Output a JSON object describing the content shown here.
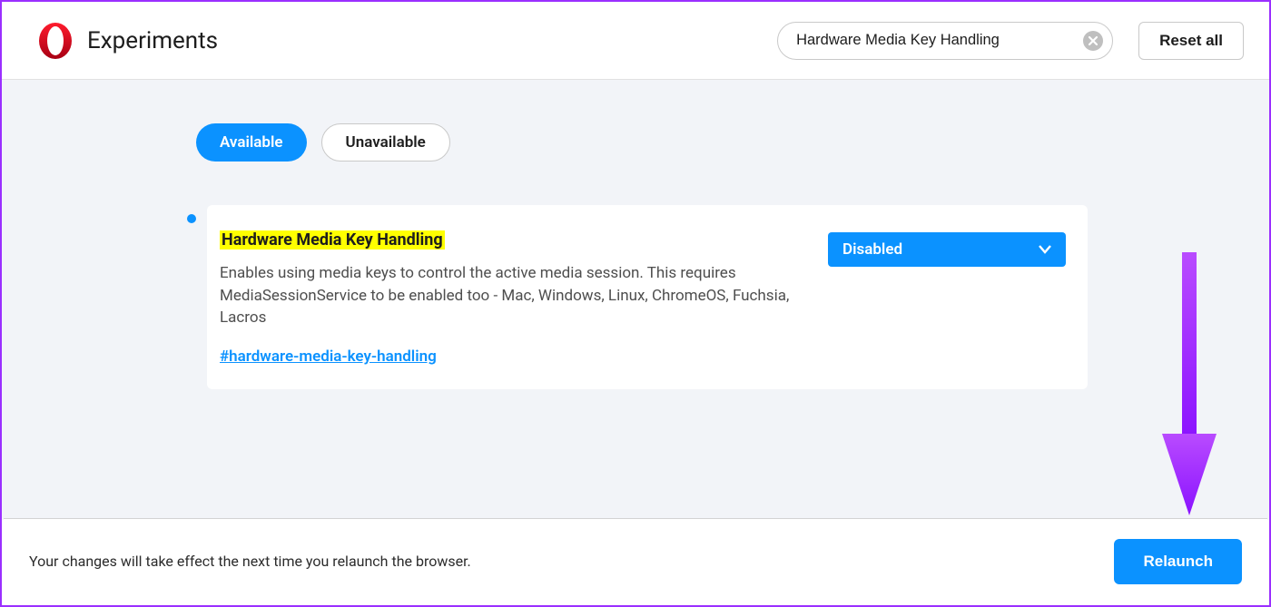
{
  "header": {
    "title": "Experiments",
    "search_value": "Hardware Media Key Handling",
    "reset_label": "Reset all"
  },
  "tabs": {
    "available": "Available",
    "unavailable": "Unavailable"
  },
  "flag": {
    "title": "Hardware Media Key Handling",
    "description": "Enables using media keys to control the active media session. This requires MediaSessionService to be enabled too - Mac, Windows, Linux, ChromeOS, Fuchsia, Lacros",
    "hash": "#hardware-media-key-handling",
    "select_value": "Disabled"
  },
  "footer": {
    "message": "Your changes will take effect the next time you relaunch the browser.",
    "relaunch_label": "Relaunch"
  }
}
